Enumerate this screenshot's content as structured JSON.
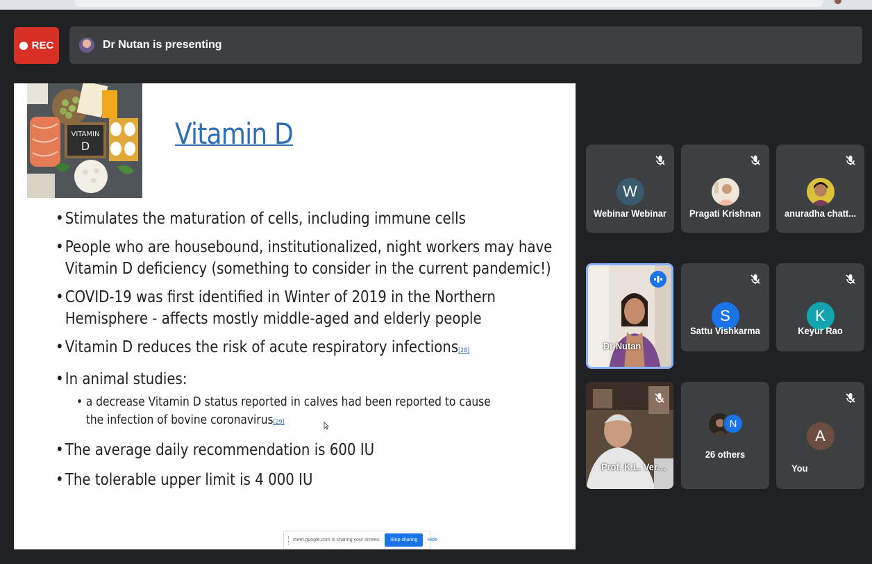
{
  "recording": {
    "label": "REC"
  },
  "presenter_bar": {
    "label": "Dr Nutan is presenting"
  },
  "slide": {
    "title": "Vitamin D",
    "bullets": [
      {
        "text": "Stimulates the maturation of cells, including immune cells"
      },
      {
        "text": "People who are housebound, institutionalized, night workers may have Vitamin D deficiency (something to consider in the current pandemic!)"
      },
      {
        "text": "COVID-19 was first identified in Winter of 2019 in the Northern Hemisphere - affects mostly middle-aged and elderly people"
      },
      {
        "text": "Vitamin D reduces the risk of acute respiratory infections",
        "ref": "[28]"
      },
      {
        "text": "In animal studies:"
      },
      {
        "text": "a decrease Vitamin D status reported in calves had been reported to cause the infection of bovine coronavirus",
        "ref": "[29]",
        "level": 2
      },
      {
        "text": "The average daily recommendation is 600 IU"
      },
      {
        "text": "The tolerable upper limit is 4 000 IU"
      }
    ],
    "photo_label": "VITAMIN D"
  },
  "share_bar": {
    "message": "meet.google.com is sharing your screen.",
    "stop_label": "Stop sharing",
    "hide_label": "Hide"
  },
  "participants": [
    {
      "name": "Webinar Webinar",
      "avatar_letter": "W",
      "avatar_color": "#3c5a6e",
      "muted": true
    },
    {
      "name": "Pragati Krishnan",
      "avatar": "photo",
      "muted": true
    },
    {
      "name": "anuradha chatt...",
      "avatar": "photo",
      "muted": true
    },
    {
      "name": "Dr Nutan",
      "avatar": "video",
      "speaking": true
    },
    {
      "name": "Sattu Vishkarma",
      "avatar_letter": "S",
      "avatar_color": "#1a73e8",
      "muted": true
    },
    {
      "name": "Keyur Rao",
      "avatar_letter": "K",
      "avatar_color": "#12a4af",
      "muted": true
    },
    {
      "name": "Prof. K.L. Verma",
      "avatar": "video",
      "muted": true
    },
    {
      "name": "26 others",
      "avatar_letter": "N",
      "avatar_color": "#1a73e8"
    },
    {
      "name": "You",
      "avatar_letter": "A",
      "avatar_color": "#6d4c41",
      "muted": true
    }
  ],
  "colors": {
    "accent": "#1a73e8",
    "rec": "#d93025",
    "tile_bg": "#3c4043",
    "page_bg": "#202124",
    "slide_title": "#2f6eb5"
  }
}
